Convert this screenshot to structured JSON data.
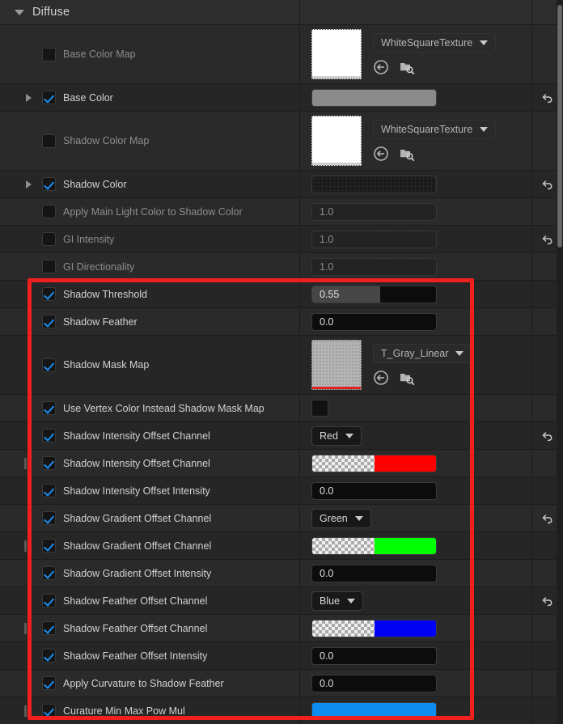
{
  "header": {
    "title": "Diffuse",
    "expand_icon": "triangle-down-icon"
  },
  "scrollbar": {
    "name": "vertical-scrollbar"
  },
  "colors": {
    "accent_checkbox": "#1b8ef2",
    "highlight_box": "#f21f1f",
    "base_color_swatch": "#8a8a8a",
    "shadow_color_swatch": "#1b1b1b",
    "red_channel": "#ff0000",
    "green_channel": "#00ff00",
    "blue_channel": "#0000f5",
    "curvature_swatch": "#0d8df0",
    "row_bg": "#2a2a2a",
    "panel_bg": "#242424"
  },
  "assets": {
    "white_square_texture": "WhiteSquareTexture",
    "gray_linear_texture": "T_Gray_Linear"
  },
  "rows": [
    {
      "id": "base-color-map",
      "label": "Base Color Map",
      "checked": false,
      "enabled": false,
      "widget": "texture",
      "asset": "WhiteSquareTexture",
      "reset": false
    },
    {
      "id": "base-color",
      "label": "Base Color",
      "checked": true,
      "enabled": true,
      "expandable": true,
      "widget": "color",
      "value": "#8a8a8a",
      "reset": true
    },
    {
      "id": "shadow-color-map",
      "label": "Shadow Color Map",
      "checked": false,
      "enabled": false,
      "widget": "texture",
      "asset": "WhiteSquareTexture",
      "reset": false
    },
    {
      "id": "shadow-color",
      "label": "Shadow Color",
      "checked": true,
      "enabled": true,
      "expandable": true,
      "widget": "color-dots",
      "value": "#1b1b1b",
      "reset": true
    },
    {
      "id": "apply-main-light-color-to-shadow-color",
      "label": "Apply Main Light Color to Shadow Color",
      "checked": false,
      "enabled": false,
      "widget": "number-dotted",
      "value": "1.0",
      "reset": false
    },
    {
      "id": "gi-intensity",
      "label": "GI Intensity",
      "checked": false,
      "enabled": false,
      "widget": "number-dotted",
      "value": "1.0",
      "reset": true
    },
    {
      "id": "gi-directionality",
      "label": "GI Directionality",
      "checked": false,
      "enabled": false,
      "widget": "number-dotted",
      "value": "1.0",
      "reset": false
    },
    {
      "id": "shadow-threshold",
      "label": "Shadow Threshold",
      "checked": true,
      "enabled": true,
      "widget": "number-slider",
      "value": "0.55",
      "fill_percent": 55,
      "reset": false
    },
    {
      "id": "shadow-feather",
      "label": "Shadow Feather",
      "checked": true,
      "enabled": true,
      "widget": "number",
      "value": "0.0",
      "reset": false
    },
    {
      "id": "shadow-mask-map",
      "label": "Shadow Mask Map",
      "checked": true,
      "enabled": true,
      "widget": "texture-gray",
      "asset": "T_Gray_Linear",
      "reset": false
    },
    {
      "id": "use-vertex-color-instead-shadow-mask-map",
      "label": "Use Vertex Color Instead Shadow Mask Map",
      "checked": true,
      "enabled": true,
      "widget": "checkbox-value",
      "value_checked": false,
      "reset": false
    },
    {
      "id": "shadow-intensity-offset-channel-dropdown",
      "label": "Shadow Intensity Offset Channel",
      "checked": true,
      "enabled": true,
      "widget": "dropdown",
      "value": "Red",
      "reset": true
    },
    {
      "id": "shadow-intensity-offset-channel-color",
      "label": "Shadow Intensity Offset Channel",
      "checked": true,
      "enabled": true,
      "nested": true,
      "widget": "color-alpha",
      "value": "#ff0000",
      "reset": false
    },
    {
      "id": "shadow-intensity-offset-intensity",
      "label": "Shadow Intensity Offset Intensity",
      "checked": true,
      "enabled": true,
      "widget": "number",
      "value": "0.0",
      "reset": false
    },
    {
      "id": "shadow-gradient-offset-channel-dropdown",
      "label": "Shadow Gradient Offset Channel",
      "checked": true,
      "enabled": true,
      "widget": "dropdown",
      "value": "Green",
      "reset": true
    },
    {
      "id": "shadow-gradient-offset-channel-color",
      "label": "Shadow Gradient Offset Channel",
      "checked": true,
      "enabled": true,
      "nested": true,
      "widget": "color-alpha",
      "value": "#00ff00",
      "reset": false
    },
    {
      "id": "shadow-gradient-offset-intensity",
      "label": "Shadow Gradient Offset Intensity",
      "checked": true,
      "enabled": true,
      "widget": "number",
      "value": "0.0",
      "reset": false
    },
    {
      "id": "shadow-feather-offset-channel-dropdown",
      "label": "Shadow Feather Offset Channel",
      "checked": true,
      "enabled": true,
      "widget": "dropdown",
      "value": "Blue",
      "reset": true
    },
    {
      "id": "shadow-feather-offset-channel-color",
      "label": "Shadow Feather Offset Channel",
      "checked": true,
      "enabled": true,
      "nested": true,
      "widget": "color-alpha",
      "value": "#0000f5",
      "reset": false
    },
    {
      "id": "shadow-feather-offset-intensity",
      "label": "Shadow Feather Offset Intensity",
      "checked": true,
      "enabled": true,
      "widget": "number",
      "value": "0.0",
      "reset": false
    },
    {
      "id": "apply-curvature-to-shadow-feather",
      "label": "Apply Curvature to Shadow Feather",
      "checked": true,
      "enabled": true,
      "widget": "number",
      "value": "0.0",
      "reset": false
    },
    {
      "id": "curature-min-max-pow-mul",
      "label": "Curature Min Max Pow Mul",
      "checked": true,
      "enabled": true,
      "nested": true,
      "widget": "color-solid",
      "value": "#0d8df0",
      "reset": false
    }
  ]
}
